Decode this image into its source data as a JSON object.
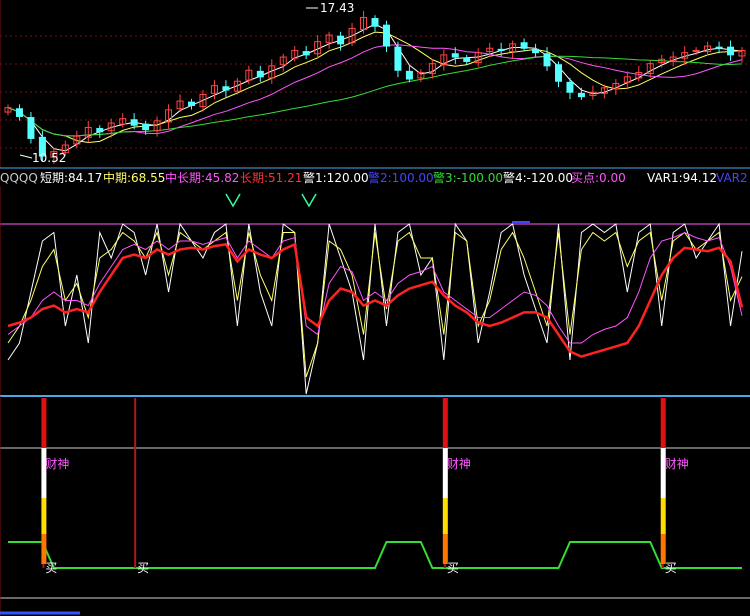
{
  "header": {
    "items": [
      {
        "text": "QQQQ",
        "color": "#c8c8c8"
      },
      {
        "text": "短期:84.17",
        "color": "#ffffff"
      },
      {
        "text": "中期:68.55",
        "color": "#ffff66"
      },
      {
        "text": "中长期:45.82",
        "color": "#ff55ff"
      },
      {
        "text": "长期:51.21",
        "color": "#ff3333"
      },
      {
        "text": "警1:120.00",
        "color": "#ffffff"
      },
      {
        "text": "警2:100.00",
        "color": "#4444ff"
      },
      {
        "text": "警3:-100.00",
        "color": "#33dd33"
      },
      {
        "text": "警4:-120.00",
        "color": "#ffffff"
      },
      {
        "text": "买点:0.00",
        "color": "#ff55ff"
      },
      {
        "text": "VAR1:94.12",
        "color": "#ffffff"
      },
      {
        "text": "VAR2",
        "color": "#4444ff"
      }
    ]
  },
  "annotations": {
    "high_label": "17.43",
    "low_label": "10.52",
    "signal_text": "财神",
    "buy_text": "买"
  },
  "colors": {
    "up_candle": "#ff4444",
    "down_candle": "#55ffff",
    "ma_fast": "#ffffff",
    "ma_mid": "#ffff66",
    "ma_slow": "#ff55ff",
    "ma_long": "#33dd33",
    "osc_long": "#ff2222",
    "grid": "#7a1010",
    "divider": "#4aa8e8"
  },
  "chart_data": [
    {
      "type": "candlestick",
      "panel": "price",
      "ylim": [
        10.52,
        17.43
      ],
      "grid": true,
      "high_marker": 17.43,
      "low_marker": 10.52,
      "series": [
        {
          "name": "close",
          "values": [
            12.9,
            12.5,
            11.5,
            10.7,
            10.9,
            11.2,
            11.6,
            12.0,
            11.8,
            12.2,
            12.4,
            12.1,
            11.9,
            12.3,
            12.8,
            13.2,
            13.0,
            13.5,
            13.9,
            13.7,
            14.1,
            14.6,
            14.3,
            14.8,
            15.2,
            15.5,
            15.3,
            15.9,
            16.2,
            15.8,
            16.5,
            17.0,
            16.6,
            15.7,
            14.6,
            14.2,
            14.5,
            14.9,
            15.3,
            15.2,
            15.0,
            15.4,
            15.6,
            15.5,
            15.8,
            15.6,
            15.4,
            14.8,
            14.1,
            13.6,
            13.4,
            13.6,
            13.8,
            14.0,
            14.3,
            14.5,
            14.9,
            15.1,
            15.2,
            15.4,
            15.5,
            15.7,
            15.6,
            15.3,
            15.5
          ]
        }
      ]
    },
    {
      "type": "line",
      "panel": "oscillator",
      "series": [
        {
          "name": "短期",
          "values": [
            20,
            30,
            60,
            90,
            95,
            40,
            70,
            30,
            95,
            80,
            100,
            95,
            70,
            100,
            60,
            100,
            90,
            80,
            95,
            100,
            40,
            100,
            60,
            40,
            100,
            95,
            0,
            30,
            100,
            80,
            60,
            20,
            100,
            40,
            95,
            100,
            70,
            80,
            20,
            100,
            90,
            30,
            60,
            95,
            100,
            70,
            50,
            30,
            100,
            20,
            95,
            100,
            95,
            100,
            60,
            95,
            100,
            40,
            95,
            100,
            80,
            90,
            100,
            40,
            84
          ]
        },
        {
          "name": "中期",
          "values": [
            30,
            40,
            55,
            75,
            85,
            55,
            65,
            45,
            80,
            85,
            95,
            90,
            80,
            95,
            70,
            95,
            90,
            85,
            90,
            95,
            55,
            95,
            70,
            55,
            95,
            95,
            10,
            30,
            90,
            85,
            70,
            35,
            95,
            50,
            90,
            95,
            80,
            80,
            35,
            95,
            90,
            40,
            55,
            85,
            95,
            80,
            60,
            40,
            95,
            35,
            85,
            95,
            90,
            95,
            75,
            90,
            95,
            55,
            90,
            95,
            85,
            90,
            95,
            55,
            69
          ]
        },
        {
          "name": "中长期",
          "values": [
            35,
            40,
            45,
            55,
            60,
            55,
            55,
            52,
            65,
            75,
            85,
            88,
            85,
            90,
            85,
            90,
            90,
            88,
            90,
            92,
            80,
            90,
            85,
            80,
            90,
            92,
            40,
            35,
            65,
            75,
            72,
            55,
            60,
            55,
            65,
            70,
            72,
            75,
            60,
            55,
            50,
            45,
            45,
            50,
            55,
            60,
            58,
            52,
            40,
            30,
            30,
            35,
            38,
            40,
            45,
            60,
            80,
            90,
            92,
            95,
            92,
            90,
            92,
            75,
            46
          ]
        },
        {
          "name": "长期",
          "values": [
            40,
            42,
            45,
            50,
            52,
            48,
            50,
            48,
            60,
            70,
            80,
            82,
            80,
            85,
            82,
            85,
            86,
            85,
            87,
            88,
            78,
            85,
            82,
            80,
            85,
            88,
            45,
            40,
            55,
            62,
            60,
            52,
            55,
            52,
            58,
            62,
            64,
            66,
            58,
            52,
            48,
            42,
            40,
            42,
            45,
            48,
            48,
            45,
            35,
            25,
            22,
            24,
            26,
            28,
            30,
            40,
            55,
            70,
            80,
            86,
            85,
            84,
            86,
            78,
            51
          ]
        }
      ],
      "reference_lines": [
        {
          "name": "警1",
          "value": 120
        },
        {
          "name": "警2",
          "value": 100
        },
        {
          "name": "警3",
          "value": -100
        },
        {
          "name": "警4",
          "value": -120
        }
      ]
    },
    {
      "type": "signal",
      "panel": "signal",
      "signal_label": "财神",
      "buy_label": "买",
      "signal_bars": [
        3,
        38,
        57
      ],
      "buy_points": [
        3,
        11,
        38,
        57
      ],
      "green_line_highs": [
        [
          0,
          3
        ],
        [
          33,
          36
        ],
        [
          49,
          56
        ]
      ]
    }
  ]
}
